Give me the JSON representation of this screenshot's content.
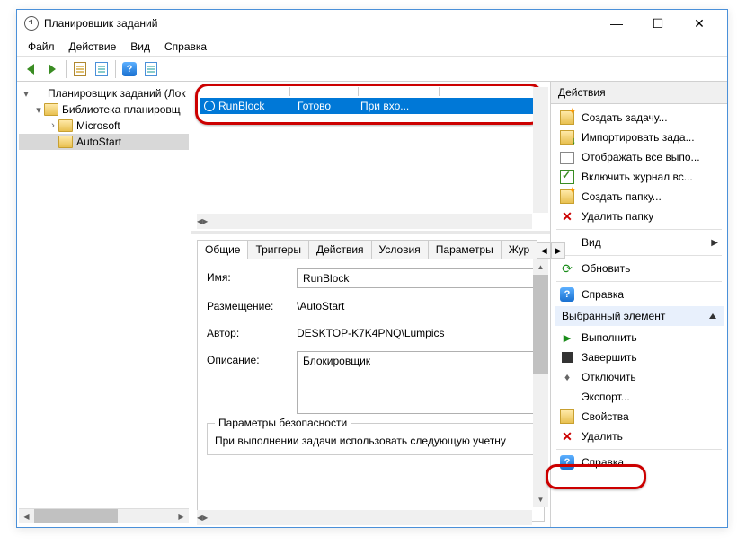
{
  "window": {
    "title": "Планировщик заданий"
  },
  "menu": {
    "file": "Файл",
    "action": "Действие",
    "view": "Вид",
    "help": "Справка"
  },
  "tree": {
    "root": "Планировщик заданий (Лок",
    "library": "Библиотека планировщ",
    "microsoft": "Microsoft",
    "autostart": "AutoStart"
  },
  "task_row": {
    "name": "RunBlock",
    "status": "Готово",
    "trigger": "При вхо..."
  },
  "tabs": {
    "general": "Общие",
    "triggers": "Триггеры",
    "actions_t": "Действия",
    "conditions": "Условия",
    "settings": "Параметры",
    "history": "Жур"
  },
  "details": {
    "name_label": "Имя:",
    "name_value": "RunBlock",
    "location_label": "Размещение:",
    "location_value": "\\AutoStart",
    "author_label": "Автор:",
    "author_value": "DESKTOP-K7K4PNQ\\Lumpics",
    "description_label": "Описание:",
    "description_value": "Блокировщик",
    "security_legend": "Параметры безопасности",
    "security_text": "При выполнении задачи использовать следующую учетну"
  },
  "actions_pane": {
    "header": "Действия",
    "create_task": "Создать задачу...",
    "import_task": "Импортировать зада...",
    "show_running": "Отображать все выпо...",
    "enable_log": "Включить журнал вс...",
    "create_folder": "Создать папку...",
    "delete_folder": "Удалить папку",
    "view": "Вид",
    "refresh": "Обновить",
    "help": "Справка",
    "selected_header": "Выбранный элемент",
    "run": "Выполнить",
    "end": "Завершить",
    "disable": "Отключить",
    "export": "Экспорт...",
    "properties": "Свойства",
    "delete": "Удалить",
    "help2": "Справка"
  }
}
